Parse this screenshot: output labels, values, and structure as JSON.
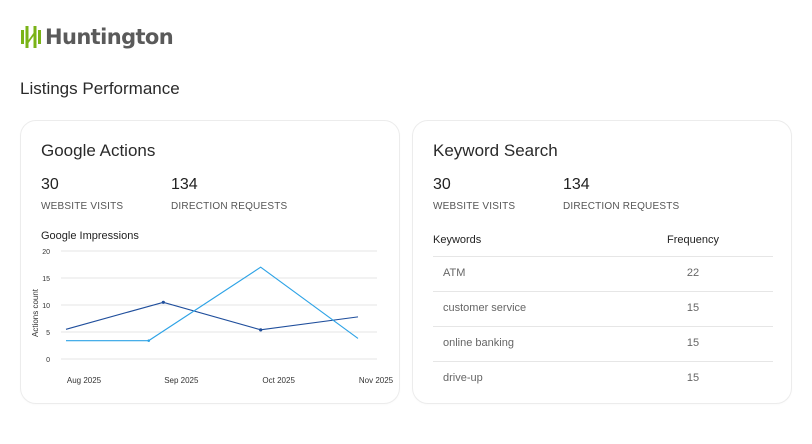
{
  "brand": {
    "name": "Huntington",
    "color": "#7ab317"
  },
  "page": {
    "section_title": "Listings Performance"
  },
  "google_actions": {
    "title": "Google Actions",
    "metrics": [
      {
        "value": "30",
        "label": "WEBSITE VISITS"
      },
      {
        "value": "134",
        "label": "DIRECTION REQUESTS"
      }
    ],
    "chart_title": "Google Impressions"
  },
  "keyword_search": {
    "title": "Keyword Search",
    "metrics": [
      {
        "value": "30",
        "label": "WEBSITE VISITS"
      },
      {
        "value": "134",
        "label": "DIRECTION REQUESTS"
      }
    ],
    "table": {
      "headers": {
        "keywords": "Keywords",
        "frequency": "Frequency"
      },
      "rows": [
        {
          "keyword": "ATM",
          "frequency": "22"
        },
        {
          "keyword": "customer service",
          "frequency": "15"
        },
        {
          "keyword": "online banking",
          "frequency": "15"
        },
        {
          "keyword": "drive-up",
          "frequency": "15"
        }
      ]
    }
  },
  "chart_data": {
    "type": "line",
    "ylabel": "Actions count",
    "ylim": [
      0,
      20
    ],
    "yticks": [
      "0",
      "5",
      "10",
      "15",
      "20"
    ],
    "x": [
      "Aug 2025",
      "Sep 2025",
      "Oct 2025",
      "Nov 2025"
    ],
    "grid": true,
    "series": [
      {
        "color": "#1f4e9c",
        "points": [
          [
            0,
            5.5
          ],
          [
            1,
            10.5
          ],
          [
            2,
            5.4
          ],
          [
            3,
            7.8
          ]
        ]
      },
      {
        "color": "#2ea3e6",
        "points": [
          [
            0,
            3.4
          ],
          [
            0.85,
            3.4
          ],
          [
            2,
            17
          ],
          [
            3,
            3.8
          ]
        ]
      }
    ]
  }
}
